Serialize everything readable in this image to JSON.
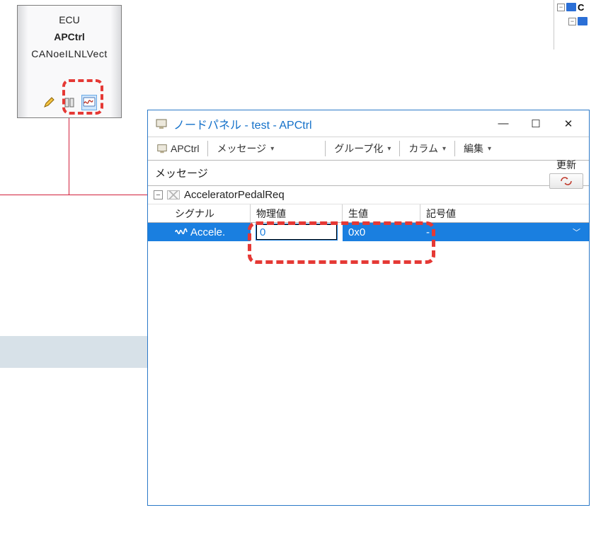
{
  "ecu_node": {
    "line1": "ECU",
    "line2": "APCtrl",
    "line3": "CANoeILNLVect",
    "icons": [
      "pencil-icon",
      "book-icon",
      "scope-icon"
    ]
  },
  "tree_sliver": {
    "row1_label": "C",
    "row2_label": ""
  },
  "dialog": {
    "title": "ノードパネル - test - APCtrl",
    "toolbar": {
      "node_label": "APCtrl",
      "msg_label": "メッセージ",
      "group_label": "グループ化",
      "column_label": "カラム",
      "edit_label": "編集"
    },
    "msgbar": {
      "label": "メッセージ",
      "refresh_label": "更新"
    },
    "message_name": "AcceleratorPedalReq",
    "columns": {
      "c1": "シグナル",
      "c2": "物理値",
      "c3": "生値",
      "c4": "記号値"
    },
    "row": {
      "signal": "Accele.",
      "phys": "0",
      "raw": "0x0",
      "sym": "-"
    }
  },
  "winbtn": {
    "min": "—",
    "max": "☐",
    "close": "✕"
  }
}
